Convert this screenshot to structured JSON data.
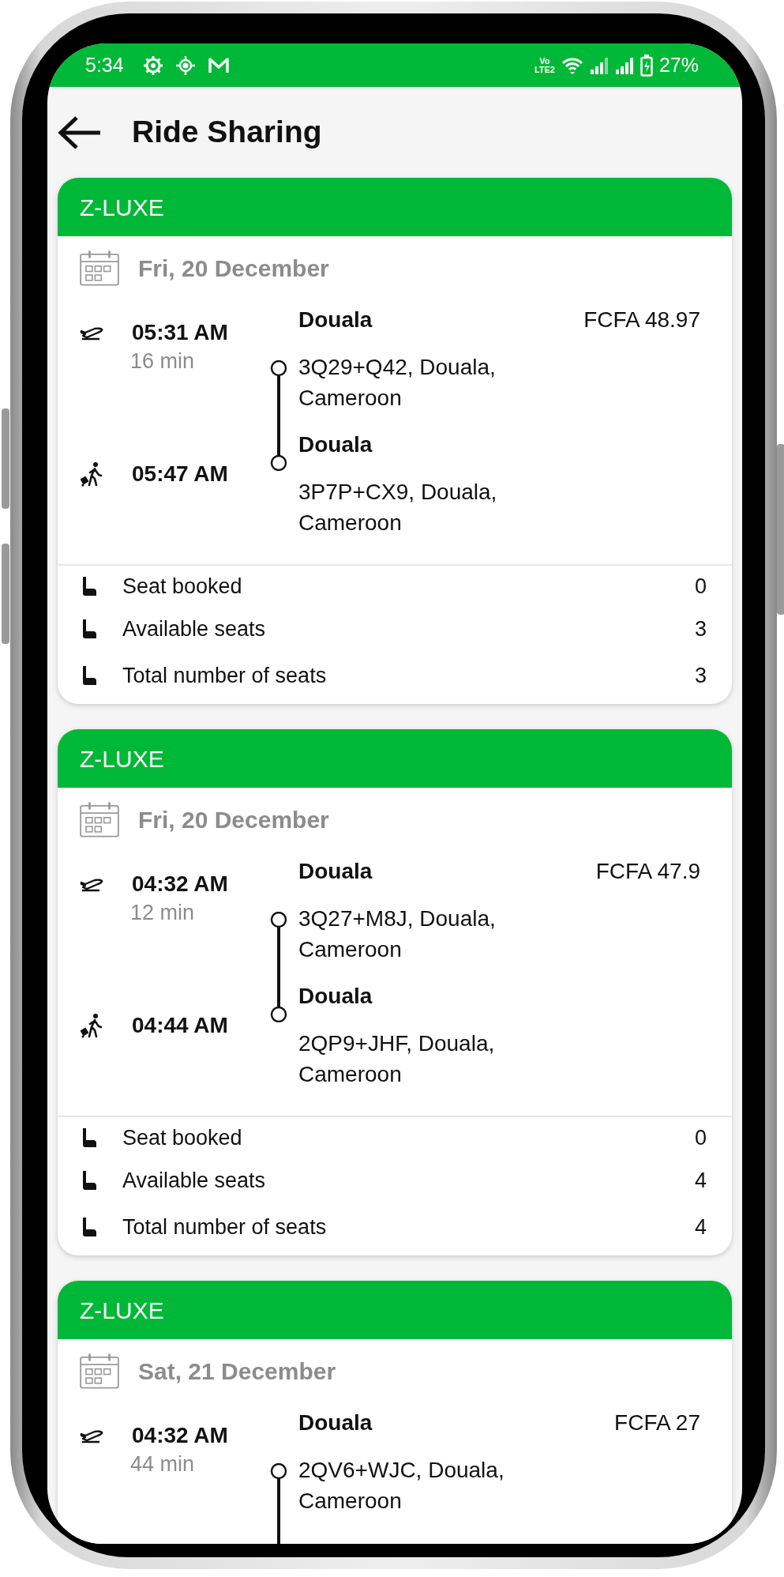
{
  "status_bar": {
    "time": "5:34",
    "network": {
      "top": "Vo",
      "bottom": "LTE2"
    },
    "battery": "27%"
  },
  "app_bar": {
    "title": "Ride Sharing"
  },
  "rides": [
    {
      "operator": "Z-LUXE",
      "date": "Fri, 20 December",
      "departure_time": "05:31 AM",
      "duration": "16 min",
      "arrival_time": "05:47 AM",
      "price": "FCFA 48.97",
      "pickup": {
        "city": "Douala",
        "address": "3Q29+Q42, Douala, Cameroon"
      },
      "dropoff": {
        "city": "Douala",
        "address": "3P7P+CX9, Douala, Cameroon"
      },
      "seats": [
        {
          "label": "Seat booked",
          "value": "0"
        },
        {
          "label": "Available seats",
          "value": "3"
        },
        {
          "label": "Total number of seats",
          "value": "3"
        }
      ]
    },
    {
      "operator": "Z-LUXE",
      "date": "Fri, 20 December",
      "departure_time": "04:32 AM",
      "duration": "12 min",
      "arrival_time": "04:44 AM",
      "price": "FCFA 47.9",
      "pickup": {
        "city": "Douala",
        "address": "3Q27+M8J, Douala, Cameroon"
      },
      "dropoff": {
        "city": "Douala",
        "address": "2QP9+JHF, Douala, Cameroon"
      },
      "seats": [
        {
          "label": "Seat booked",
          "value": "0"
        },
        {
          "label": "Available seats",
          "value": "4"
        },
        {
          "label": "Total number of seats",
          "value": "4"
        }
      ]
    },
    {
      "operator": "Z-LUXE",
      "date": "Sat, 21 December",
      "departure_time": "04:32 AM",
      "duration": "44 min",
      "price": "FCFA 27",
      "pickup": {
        "city": "Douala",
        "address": "2QV6+WJC, Douala, Cameroon"
      }
    }
  ]
}
